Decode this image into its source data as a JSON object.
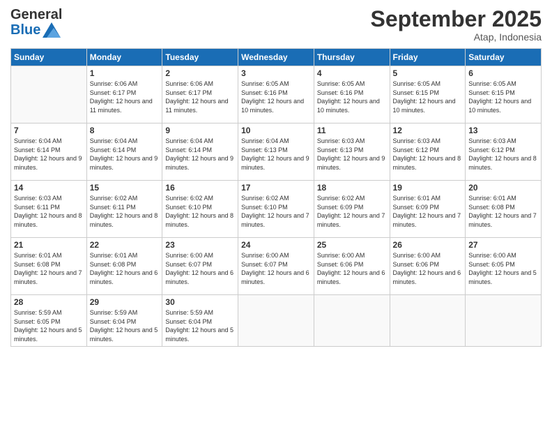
{
  "logo": {
    "general": "General",
    "blue": "Blue"
  },
  "header": {
    "month": "September 2025",
    "location": "Atap, Indonesia"
  },
  "weekdays": [
    "Sunday",
    "Monday",
    "Tuesday",
    "Wednesday",
    "Thursday",
    "Friday",
    "Saturday"
  ],
  "weeks": [
    [
      {
        "day": "",
        "sunrise": "",
        "sunset": "",
        "daylight": ""
      },
      {
        "day": "1",
        "sunrise": "Sunrise: 6:06 AM",
        "sunset": "Sunset: 6:17 PM",
        "daylight": "Daylight: 12 hours and 11 minutes."
      },
      {
        "day": "2",
        "sunrise": "Sunrise: 6:06 AM",
        "sunset": "Sunset: 6:17 PM",
        "daylight": "Daylight: 12 hours and 11 minutes."
      },
      {
        "day": "3",
        "sunrise": "Sunrise: 6:05 AM",
        "sunset": "Sunset: 6:16 PM",
        "daylight": "Daylight: 12 hours and 10 minutes."
      },
      {
        "day": "4",
        "sunrise": "Sunrise: 6:05 AM",
        "sunset": "Sunset: 6:16 PM",
        "daylight": "Daylight: 12 hours and 10 minutes."
      },
      {
        "day": "5",
        "sunrise": "Sunrise: 6:05 AM",
        "sunset": "Sunset: 6:15 PM",
        "daylight": "Daylight: 12 hours and 10 minutes."
      },
      {
        "day": "6",
        "sunrise": "Sunrise: 6:05 AM",
        "sunset": "Sunset: 6:15 PM",
        "daylight": "Daylight: 12 hours and 10 minutes."
      }
    ],
    [
      {
        "day": "7",
        "sunrise": "Sunrise: 6:04 AM",
        "sunset": "Sunset: 6:14 PM",
        "daylight": "Daylight: 12 hours and 9 minutes."
      },
      {
        "day": "8",
        "sunrise": "Sunrise: 6:04 AM",
        "sunset": "Sunset: 6:14 PM",
        "daylight": "Daylight: 12 hours and 9 minutes."
      },
      {
        "day": "9",
        "sunrise": "Sunrise: 6:04 AM",
        "sunset": "Sunset: 6:14 PM",
        "daylight": "Daylight: 12 hours and 9 minutes."
      },
      {
        "day": "10",
        "sunrise": "Sunrise: 6:04 AM",
        "sunset": "Sunset: 6:13 PM",
        "daylight": "Daylight: 12 hours and 9 minutes."
      },
      {
        "day": "11",
        "sunrise": "Sunrise: 6:03 AM",
        "sunset": "Sunset: 6:13 PM",
        "daylight": "Daylight: 12 hours and 9 minutes."
      },
      {
        "day": "12",
        "sunrise": "Sunrise: 6:03 AM",
        "sunset": "Sunset: 6:12 PM",
        "daylight": "Daylight: 12 hours and 8 minutes."
      },
      {
        "day": "13",
        "sunrise": "Sunrise: 6:03 AM",
        "sunset": "Sunset: 6:12 PM",
        "daylight": "Daylight: 12 hours and 8 minutes."
      }
    ],
    [
      {
        "day": "14",
        "sunrise": "Sunrise: 6:03 AM",
        "sunset": "Sunset: 6:11 PM",
        "daylight": "Daylight: 12 hours and 8 minutes."
      },
      {
        "day": "15",
        "sunrise": "Sunrise: 6:02 AM",
        "sunset": "Sunset: 6:11 PM",
        "daylight": "Daylight: 12 hours and 8 minutes."
      },
      {
        "day": "16",
        "sunrise": "Sunrise: 6:02 AM",
        "sunset": "Sunset: 6:10 PM",
        "daylight": "Daylight: 12 hours and 8 minutes."
      },
      {
        "day": "17",
        "sunrise": "Sunrise: 6:02 AM",
        "sunset": "Sunset: 6:10 PM",
        "daylight": "Daylight: 12 hours and 7 minutes."
      },
      {
        "day": "18",
        "sunrise": "Sunrise: 6:02 AM",
        "sunset": "Sunset: 6:09 PM",
        "daylight": "Daylight: 12 hours and 7 minutes."
      },
      {
        "day": "19",
        "sunrise": "Sunrise: 6:01 AM",
        "sunset": "Sunset: 6:09 PM",
        "daylight": "Daylight: 12 hours and 7 minutes."
      },
      {
        "day": "20",
        "sunrise": "Sunrise: 6:01 AM",
        "sunset": "Sunset: 6:08 PM",
        "daylight": "Daylight: 12 hours and 7 minutes."
      }
    ],
    [
      {
        "day": "21",
        "sunrise": "Sunrise: 6:01 AM",
        "sunset": "Sunset: 6:08 PM",
        "daylight": "Daylight: 12 hours and 7 minutes."
      },
      {
        "day": "22",
        "sunrise": "Sunrise: 6:01 AM",
        "sunset": "Sunset: 6:08 PM",
        "daylight": "Daylight: 12 hours and 6 minutes."
      },
      {
        "day": "23",
        "sunrise": "Sunrise: 6:00 AM",
        "sunset": "Sunset: 6:07 PM",
        "daylight": "Daylight: 12 hours and 6 minutes."
      },
      {
        "day": "24",
        "sunrise": "Sunrise: 6:00 AM",
        "sunset": "Sunset: 6:07 PM",
        "daylight": "Daylight: 12 hours and 6 minutes."
      },
      {
        "day": "25",
        "sunrise": "Sunrise: 6:00 AM",
        "sunset": "Sunset: 6:06 PM",
        "daylight": "Daylight: 12 hours and 6 minutes."
      },
      {
        "day": "26",
        "sunrise": "Sunrise: 6:00 AM",
        "sunset": "Sunset: 6:06 PM",
        "daylight": "Daylight: 12 hours and 6 minutes."
      },
      {
        "day": "27",
        "sunrise": "Sunrise: 6:00 AM",
        "sunset": "Sunset: 6:05 PM",
        "daylight": "Daylight: 12 hours and 5 minutes."
      }
    ],
    [
      {
        "day": "28",
        "sunrise": "Sunrise: 5:59 AM",
        "sunset": "Sunset: 6:05 PM",
        "daylight": "Daylight: 12 hours and 5 minutes."
      },
      {
        "day": "29",
        "sunrise": "Sunrise: 5:59 AM",
        "sunset": "Sunset: 6:04 PM",
        "daylight": "Daylight: 12 hours and 5 minutes."
      },
      {
        "day": "30",
        "sunrise": "Sunrise: 5:59 AM",
        "sunset": "Sunset: 6:04 PM",
        "daylight": "Daylight: 12 hours and 5 minutes."
      },
      {
        "day": "",
        "sunrise": "",
        "sunset": "",
        "daylight": ""
      },
      {
        "day": "",
        "sunrise": "",
        "sunset": "",
        "daylight": ""
      },
      {
        "day": "",
        "sunrise": "",
        "sunset": "",
        "daylight": ""
      },
      {
        "day": "",
        "sunrise": "",
        "sunset": "",
        "daylight": ""
      }
    ]
  ]
}
